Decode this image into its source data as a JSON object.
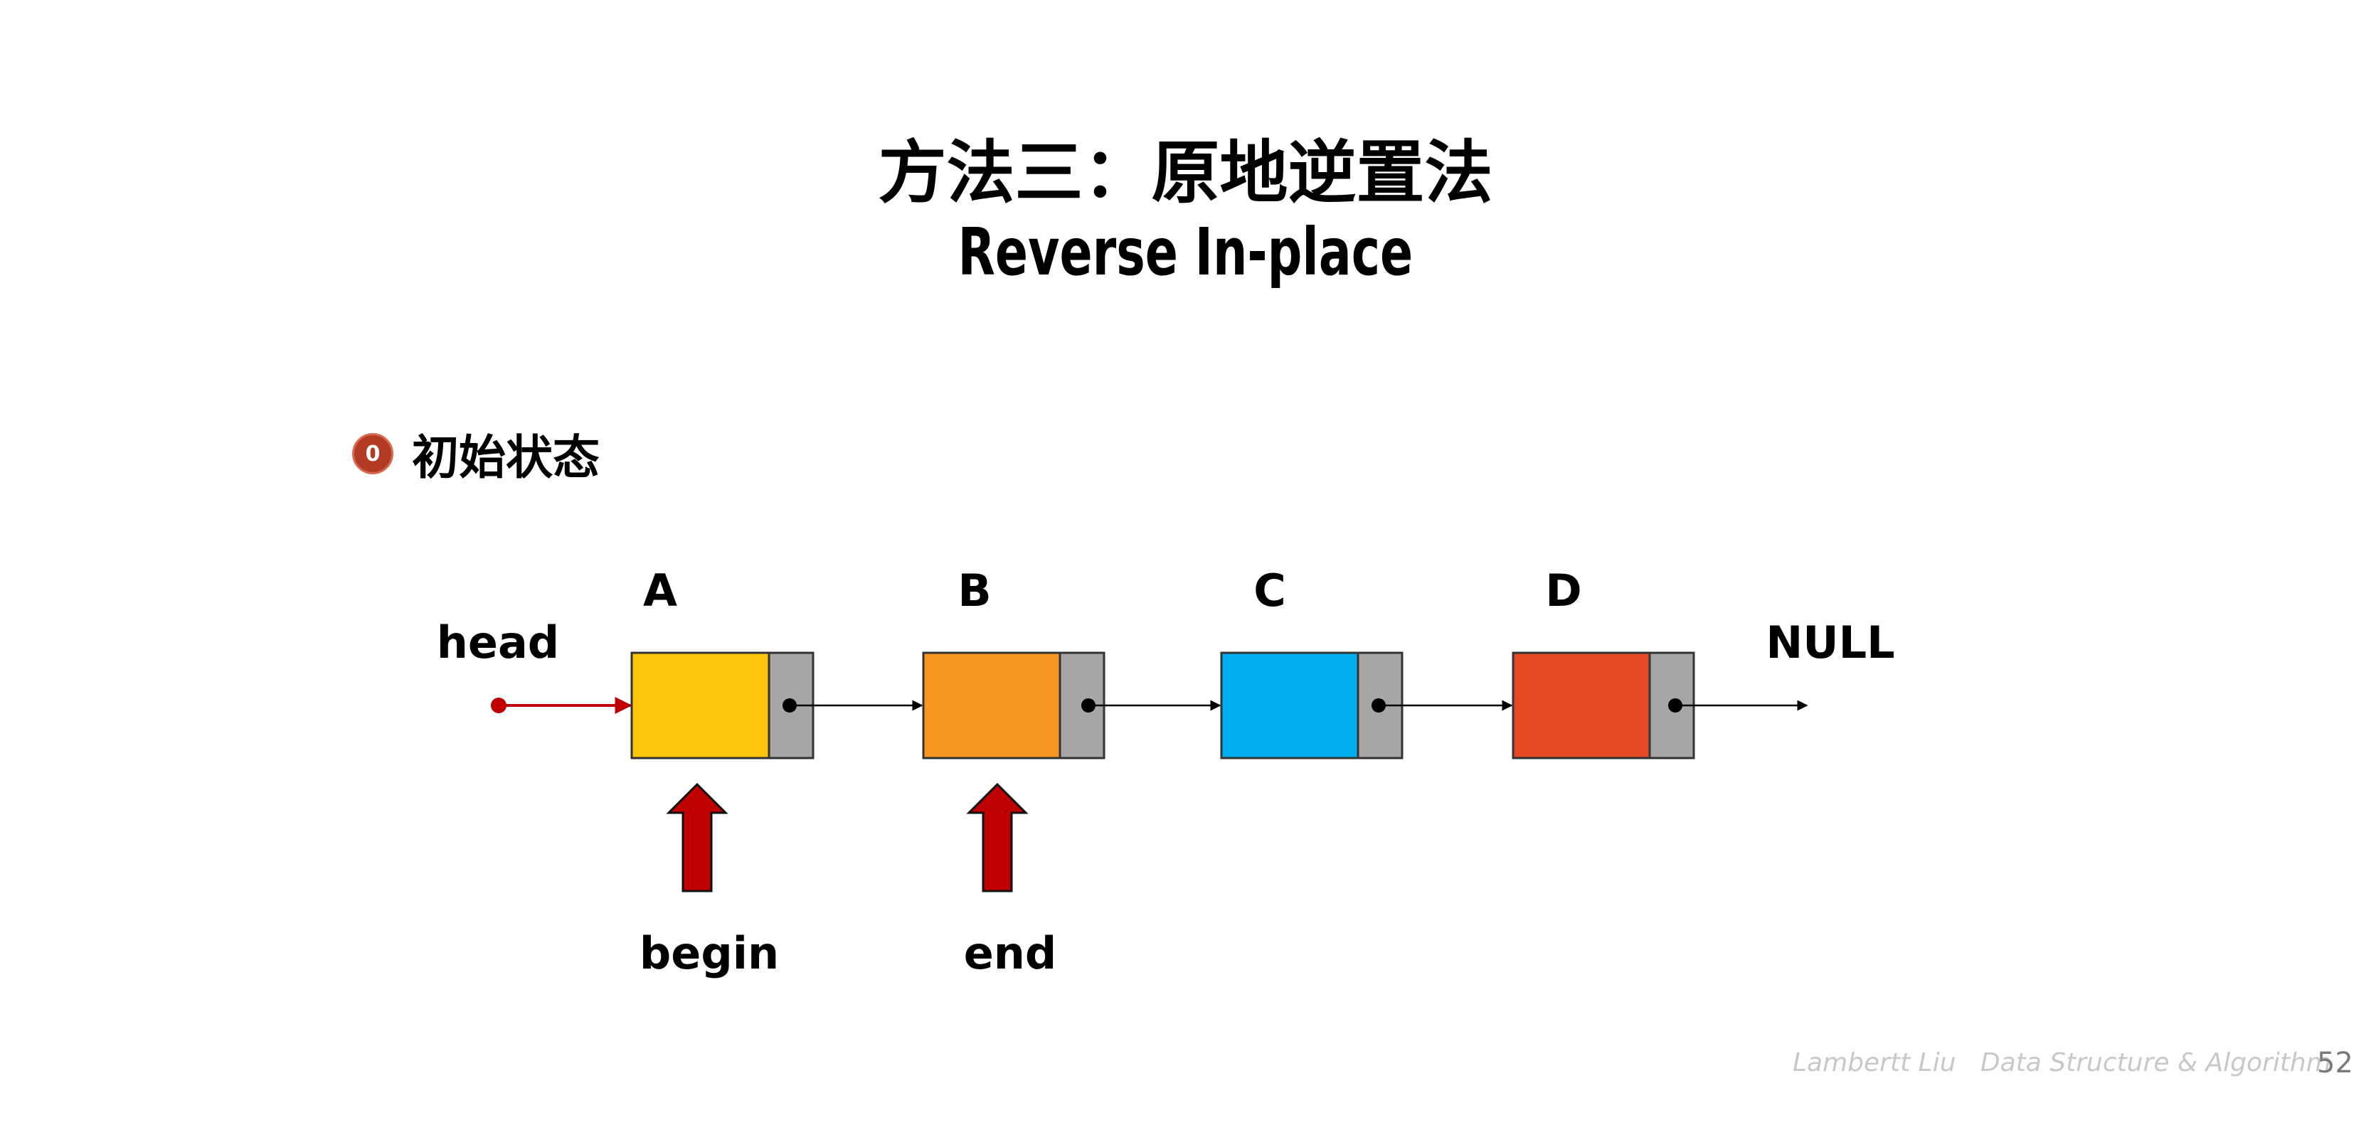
{
  "slide": {
    "title_cn": "方法三：原地逆置法",
    "title_en": "Reverse In-place",
    "step_number": "0",
    "step_label": "初始状态",
    "footer_author": "Lambertt Liu",
    "footer_course": "Data Structure & Algorithm",
    "page_number": "52"
  },
  "diagram": {
    "head_label": "head",
    "null_label": "NULL",
    "nodes": [
      {
        "label": "A",
        "color": "#fec60b"
      },
      {
        "label": "B",
        "color": "#f79521"
      },
      {
        "label": "C",
        "color": "#00aeef"
      },
      {
        "label": "D",
        "color": "#e64a24"
      }
    ],
    "pointer_box_color": "#a6a6a6",
    "head_arrow_color": "#c00000",
    "pointers": [
      {
        "label": "begin",
        "target": "A"
      },
      {
        "label": "end",
        "target": "B"
      }
    ]
  }
}
